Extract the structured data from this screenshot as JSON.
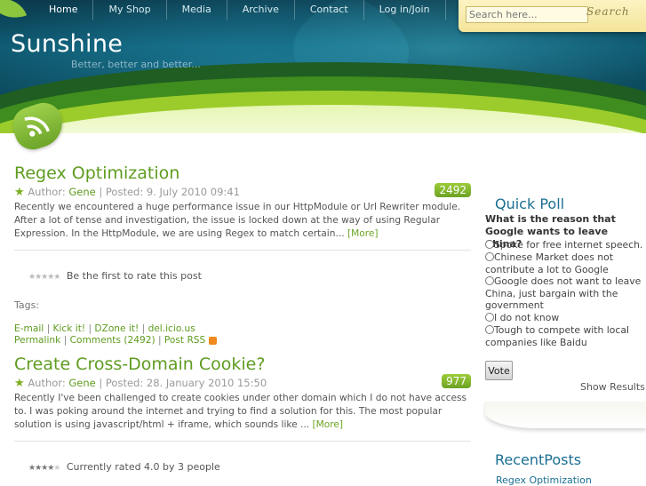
{
  "nav": {
    "items": [
      "Home",
      "My Shop",
      "Media",
      "Archive",
      "Contact",
      "Log in/Join"
    ]
  },
  "site": {
    "title": "Sunshine",
    "tagline": "Better, better and better..."
  },
  "search": {
    "placeholder": "Search here...",
    "button_label": "Search"
  },
  "posts": [
    {
      "title": "Regex Optimization",
      "author_label": "Author:",
      "author": "Gene",
      "posted": "| Posted: 9. July 2010 09:41",
      "comment_count": "2492",
      "excerpt": "Recently we encountered a huge performance issue in our HttpModule or Url Rewriter module. After a lot of tense and investigation, the issue is locked down at the way of using Regular Expression. In the HttpModule, we are using Regex to match certain...",
      "more": "[More]",
      "rating_text": "Be the first to rate this post",
      "tags_label": "Tags:",
      "share": {
        "email": "E-mail",
        "kickit": "Kick it!",
        "dzone": "DZone it!",
        "delicious": "del.icio.us",
        "permalink": "Permalink",
        "comments": "Comments (2492)",
        "rss": "Post RSS"
      }
    },
    {
      "title": "Create Cross-Domain Cookie?",
      "author_label": "Author:",
      "author": "Gene",
      "posted": "| Posted: 28. January 2010 15:50",
      "comment_count": "977",
      "excerpt": "Recently I've been challenged to create cookies under other domain which I do not have access to. I was poking around the internet and trying to find a solution for this. The most popular solution is using javascript/html + iframe, which sounds like ...",
      "more": "[More]",
      "rating_text": "Currently rated 4.0 by 3 people",
      "rating_value": 4
    }
  ],
  "poll": {
    "title": "Quick Poll",
    "question": "What is the reason that Google wants to leave China?",
    "options": [
      "Spoke for free internet speech.",
      "Chinese Market does not contribute a lot to Google",
      "Google does not want to leave China, just bargain with the government",
      "I do not know",
      "Tough to compete with local companies like Baidu"
    ],
    "vote_label": "Vote",
    "results_label": "Show Results"
  },
  "recent_posts": {
    "title": "RecentPosts",
    "items": [
      "Regex Optimization"
    ]
  },
  "colors": {
    "accent_green": "#5f9c20",
    "header_blue": "#0e5a72",
    "link_blue": "#1b6f92"
  }
}
